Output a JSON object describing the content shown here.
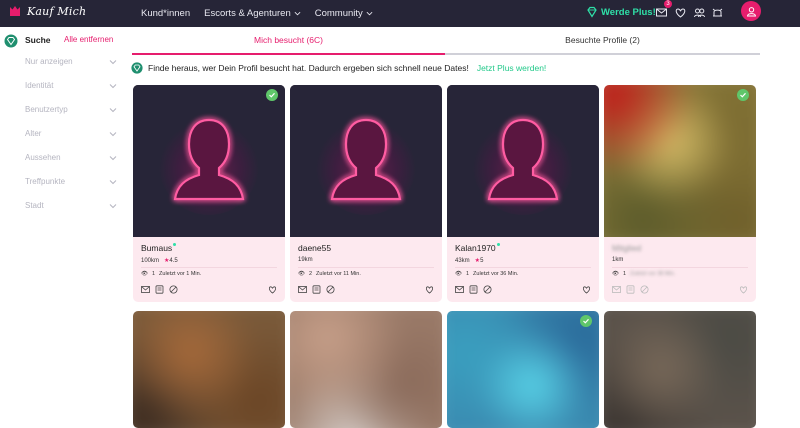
{
  "brand": {
    "name": "Kauf Mich"
  },
  "nav": {
    "links": [
      {
        "label": "Kund*innen"
      },
      {
        "label": "Escorts & Agenturen"
      },
      {
        "label": "Community"
      }
    ],
    "plus_label": "Werde Plus!",
    "message_badge": "3"
  },
  "sidebar": {
    "title": "Suche",
    "clear_label": "Alle entfernen",
    "filters": [
      {
        "label": "Nur anzeigen"
      },
      {
        "label": "Identität"
      },
      {
        "label": "Benutzertyp"
      },
      {
        "label": "Alter"
      },
      {
        "label": "Aussehen"
      },
      {
        "label": "Treffpunkte"
      },
      {
        "label": "Stadt"
      }
    ]
  },
  "tabs": [
    {
      "label": "Mich besucht (6C)"
    },
    {
      "label": "Besuchte Profile (2)"
    }
  ],
  "promo": {
    "text": "Finde heraus, wer Dein Profil besucht hat. Dadurch ergeben sich schnell neue Dates!",
    "link": "Jetzt Plus werden!"
  },
  "cards": [
    {
      "name": "Bumaus",
      "distance": "100km",
      "rating": "4.5",
      "visits": "1",
      "last_seen": "Zuletzt vor 1 Min."
    },
    {
      "name": "daene55",
      "distance": "19km",
      "rating": "",
      "visits": "2",
      "last_seen": "Zuletzt vor 11 Min."
    },
    {
      "name": "Kalan1970",
      "distance": "43km",
      "rating": "5",
      "visits": "1",
      "last_seen": "Zuletzt vor 36 Min."
    },
    {
      "name": "Mitglied",
      "distance": "1km",
      "rating": "",
      "visits": "1",
      "last_seen": "Zuletzt vor 38 Min."
    }
  ],
  "colors": {
    "accent": "#e61d6d",
    "nav_bg": "#262537",
    "plus": "#2fe0a8",
    "card_bg": "#fde9ef"
  }
}
